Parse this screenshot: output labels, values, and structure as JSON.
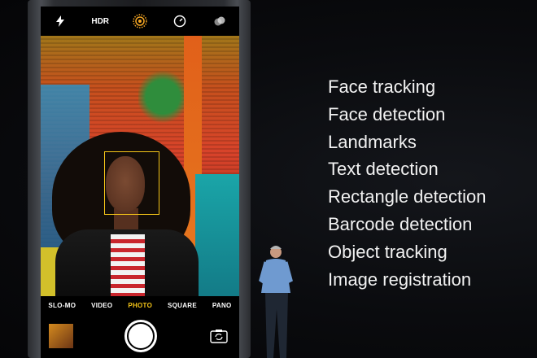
{
  "camera": {
    "top_bar": {
      "flash_icon": "flash-icon",
      "hdr_label": "HDR",
      "live_icon": "live-photo-icon",
      "timer_icon": "timer-icon",
      "filter_icon": "filters-icon"
    },
    "modes": [
      "SLO-MO",
      "VIDEO",
      "PHOTO",
      "SQUARE",
      "PANO"
    ],
    "active_mode": "PHOTO",
    "accent_color": "#f5c518"
  },
  "features": [
    "Face tracking",
    "Face detection",
    "Landmarks",
    "Text detection",
    "Rectangle detection",
    "Barcode detection",
    "Object tracking",
    "Image registration"
  ]
}
